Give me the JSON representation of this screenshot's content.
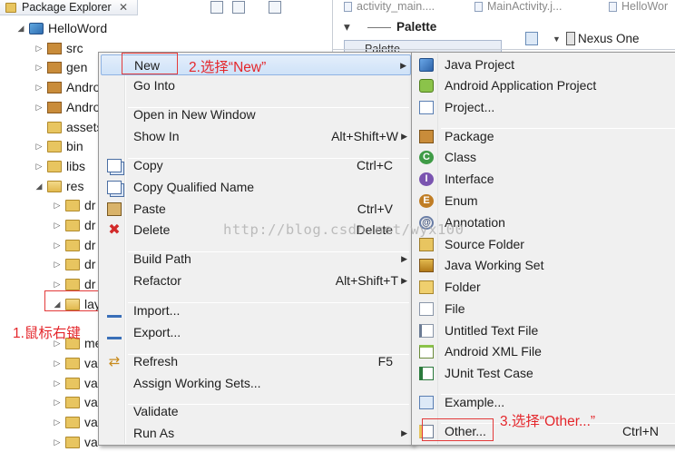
{
  "explorer": {
    "title": "Package Explorer",
    "close_glyph": "✕",
    "rows": [
      {
        "label": "HelloWord",
        "arrow": "◢",
        "icon": "project-icon",
        "cls": "project",
        "indent": 0
      },
      {
        "label": "src",
        "arrow": "▷",
        "icon": "src-folder-icon",
        "cls": "pkg",
        "indent": 1
      },
      {
        "label": "gen",
        "arrow": "▷",
        "icon": "gen-folder-icon",
        "cls": "pkg",
        "indent": 1
      },
      {
        "label": "Andro",
        "arrow": "▷",
        "icon": "library-icon",
        "cls": "pkg",
        "indent": 1
      },
      {
        "label": "Andro",
        "arrow": "▷",
        "icon": "library-icon",
        "cls": "pkg",
        "indent": 1
      },
      {
        "label": "assets",
        "arrow": "",
        "icon": "folder-icon",
        "cls": "folder",
        "indent": 1
      },
      {
        "label": "bin",
        "arrow": "▷",
        "icon": "folder-icon",
        "cls": "folder",
        "indent": 1
      },
      {
        "label": "libs",
        "arrow": "▷",
        "icon": "folder-icon",
        "cls": "folder",
        "indent": 1
      },
      {
        "label": "res",
        "arrow": "◢",
        "icon": "folder-open-icon",
        "cls": "folder-open",
        "indent": 1
      },
      {
        "label": "dr",
        "arrow": "▷",
        "icon": "folder-icon",
        "cls": "folder",
        "indent": 2
      },
      {
        "label": "dr",
        "arrow": "▷",
        "icon": "folder-icon",
        "cls": "folder",
        "indent": 2
      },
      {
        "label": "dr",
        "arrow": "▷",
        "icon": "folder-icon",
        "cls": "folder",
        "indent": 2
      },
      {
        "label": "dr",
        "arrow": "▷",
        "icon": "folder-icon",
        "cls": "folder",
        "indent": 2
      },
      {
        "label": "dr",
        "arrow": "▷",
        "icon": "folder-icon",
        "cls": "folder",
        "indent": 2
      },
      {
        "label": "lay",
        "arrow": "◢",
        "icon": "folder-open-icon",
        "cls": "folder-open",
        "indent": 2
      },
      {
        "label": "",
        "arrow": "",
        "icon": "",
        "cls": "",
        "indent": 3
      },
      {
        "label": "me",
        "arrow": "▷",
        "icon": "folder-icon",
        "cls": "folder",
        "indent": 2
      },
      {
        "label": "va",
        "arrow": "▷",
        "icon": "folder-icon",
        "cls": "folder",
        "indent": 2
      },
      {
        "label": "va",
        "arrow": "▷",
        "icon": "folder-icon",
        "cls": "folder",
        "indent": 2
      },
      {
        "label": "va",
        "arrow": "▷",
        "icon": "folder-icon",
        "cls": "folder",
        "indent": 2
      },
      {
        "label": "va",
        "arrow": "▷",
        "icon": "folder-icon",
        "cls": "folder",
        "indent": 2
      },
      {
        "label": "va",
        "arrow": "▷",
        "icon": "folder-icon",
        "cls": "folder",
        "indent": 2
      }
    ]
  },
  "editor": {
    "tabs": [
      "activity_main....",
      "MainActivity.j...",
      "HelloWor"
    ],
    "palette_title": "Palette",
    "palette_item": "Palette",
    "device": "Nexus One"
  },
  "context_menu": {
    "items": [
      {
        "label": "New",
        "shortcut": "",
        "submenu": true,
        "icon": "",
        "highlight": true
      },
      {
        "label": "Go Into",
        "shortcut": "",
        "submenu": false,
        "icon": ""
      },
      {
        "sep": true
      },
      {
        "label": "Open in New Window",
        "shortcut": "",
        "submenu": false,
        "icon": ""
      },
      {
        "label": "Show In",
        "shortcut": "Alt+Shift+W",
        "submenu": true,
        "icon": ""
      },
      {
        "sep": true
      },
      {
        "label": "Copy",
        "shortcut": "Ctrl+C",
        "submenu": false,
        "icon": "copy-icon"
      },
      {
        "label": "Copy Qualified Name",
        "shortcut": "",
        "submenu": false,
        "icon": "copy-icon"
      },
      {
        "label": "Paste",
        "shortcut": "Ctrl+V",
        "submenu": false,
        "icon": "paste-icon"
      },
      {
        "label": "Delete",
        "shortcut": "Delete",
        "submenu": false,
        "icon": "delete-icon"
      },
      {
        "sep": true
      },
      {
        "label": "Build Path",
        "shortcut": "",
        "submenu": true,
        "icon": ""
      },
      {
        "label": "Refactor",
        "shortcut": "Alt+Shift+T",
        "submenu": true,
        "icon": ""
      },
      {
        "sep": true
      },
      {
        "label": "Import...",
        "shortcut": "",
        "submenu": false,
        "icon": "import-icon"
      },
      {
        "label": "Export...",
        "shortcut": "",
        "submenu": false,
        "icon": "export-icon"
      },
      {
        "sep": true
      },
      {
        "label": "Refresh",
        "shortcut": "F5",
        "submenu": false,
        "icon": "refresh-icon"
      },
      {
        "label": "Assign Working Sets...",
        "shortcut": "",
        "submenu": false,
        "icon": ""
      },
      {
        "sep": true
      },
      {
        "label": "Validate",
        "shortcut": "",
        "submenu": false,
        "icon": ""
      },
      {
        "label": "Run As",
        "shortcut": "",
        "submenu": true,
        "icon": ""
      }
    ]
  },
  "new_submenu": {
    "items": [
      {
        "label": "Java Project",
        "shortcut": "",
        "icon": "java-project-icon",
        "cls": "ic-java"
      },
      {
        "label": "Android Application Project",
        "shortcut": "",
        "icon": "android-project-icon",
        "cls": "ic-android"
      },
      {
        "label": "Project...",
        "shortcut": "",
        "icon": "project-icon",
        "cls": "ic-proj"
      },
      {
        "sep": true
      },
      {
        "label": "Package",
        "shortcut": "",
        "icon": "package-icon",
        "cls": "ic-pkg"
      },
      {
        "label": "Class",
        "shortcut": "",
        "icon": "class-icon",
        "cls": "ic-class",
        "glyph": "C"
      },
      {
        "label": "Interface",
        "shortcut": "",
        "icon": "interface-icon",
        "cls": "ic-iface",
        "glyph": "I"
      },
      {
        "label": "Enum",
        "shortcut": "",
        "icon": "enum-icon",
        "cls": "ic-enum",
        "glyph": "E"
      },
      {
        "label": "Annotation",
        "shortcut": "",
        "icon": "annotation-icon",
        "cls": "ic-annot",
        "glyph": "@"
      },
      {
        "label": "Source Folder",
        "shortcut": "",
        "icon": "source-folder-icon",
        "cls": "ic-srcf"
      },
      {
        "label": "Java Working Set",
        "shortcut": "",
        "icon": "working-set-icon",
        "cls": "ic-jset"
      },
      {
        "label": "Folder",
        "shortcut": "",
        "icon": "folder-icon",
        "cls": "ic-folder"
      },
      {
        "label": "File",
        "shortcut": "",
        "icon": "file-icon",
        "cls": "ic-file"
      },
      {
        "label": "Untitled Text File",
        "shortcut": "",
        "icon": "text-file-icon",
        "cls": "ic-txt"
      },
      {
        "label": "Android XML File",
        "shortcut": "",
        "icon": "xml-file-icon",
        "cls": "ic-xml"
      },
      {
        "label": "JUnit Test Case",
        "shortcut": "",
        "icon": "junit-icon",
        "cls": "ic-junit"
      },
      {
        "sep": true
      },
      {
        "label": "Example...",
        "shortcut": "",
        "icon": "example-icon",
        "cls": "ic-example"
      },
      {
        "sep": true
      },
      {
        "label": "Other...",
        "shortcut": "Ctrl+N",
        "icon": "other-wizard-icon",
        "cls": "ic-other"
      }
    ]
  },
  "annotations": {
    "step1": "1.鼠标右键",
    "step2": "2.选择“New”",
    "step3": "3.选择“Other...”"
  },
  "watermark": "http://blog.csdn.net/wyx100",
  "colors": {
    "annotation": "#e4262b",
    "menu_bg": "#f0f0f0",
    "highlight": "#cfe2f8"
  }
}
